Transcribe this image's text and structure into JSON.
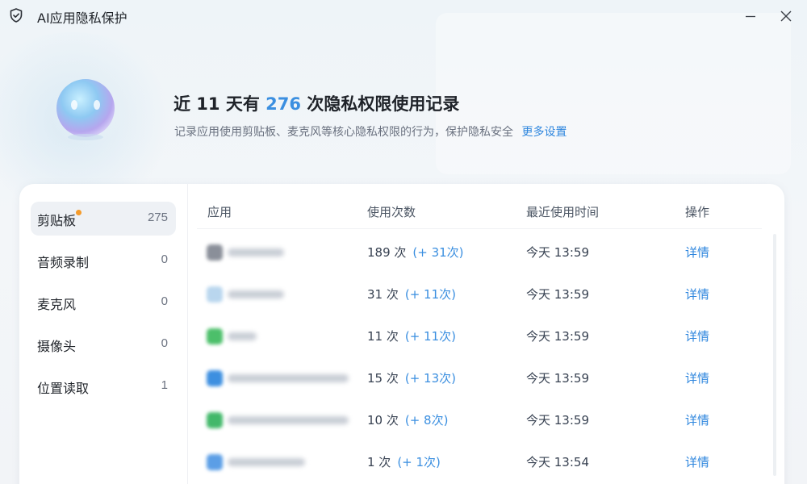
{
  "window": {
    "title": "AI应用隐私保护",
    "icons": {
      "app": "shield-icon",
      "minimize": "minimize-icon",
      "close": "close-icon"
    }
  },
  "header": {
    "headline_prefix": "近 11 天有 ",
    "headline_count": "276",
    "headline_suffix": " 次隐私权限使用记录",
    "subline": "记录应用使用剪贴板、麦克风等核心隐私权限的行为，保护隐私安全",
    "more_link": "更多设置"
  },
  "sidebar": {
    "items": [
      {
        "label": "剪贴板",
        "count": "275",
        "active": true,
        "dot": true
      },
      {
        "label": "音频录制",
        "count": "0",
        "active": false,
        "dot": false
      },
      {
        "label": "麦克风",
        "count": "0",
        "active": false,
        "dot": false
      },
      {
        "label": "摄像头",
        "count": "0",
        "active": false,
        "dot": false
      },
      {
        "label": "位置读取",
        "count": "1",
        "active": false,
        "dot": false
      }
    ]
  },
  "table": {
    "columns": [
      "应用",
      "使用次数",
      "最近使用时间",
      "操作"
    ],
    "rows": [
      {
        "count": "189 次",
        "delta": "(+ 31次)",
        "time": "今天 13:59",
        "action": "详情",
        "logo_color": "#8a8f99"
      },
      {
        "count": "31 次",
        "delta": "(+ 11次)",
        "time": "今天 13:59",
        "action": "详情",
        "logo_color": "#b9d6ee"
      },
      {
        "count": "11 次",
        "delta": "(+ 11次)",
        "time": "今天 13:59",
        "action": "详情",
        "logo_color": "#4cbf6a"
      },
      {
        "count": "15 次",
        "delta": "(+ 13次)",
        "time": "今天 13:59",
        "action": "详情",
        "logo_color": "#3d8fe0"
      },
      {
        "count": "10 次",
        "delta": "(+ 8次)",
        "time": "今天 13:59",
        "action": "详情",
        "logo_color": "#42b86a"
      },
      {
        "count": "1 次",
        "delta": "(+ 1次)",
        "time": "今天 13:54",
        "action": "详情",
        "logo_color": "#5b9ee6"
      }
    ]
  },
  "colors": {
    "accent": "#3b8fe0",
    "link": "#2e86de",
    "badge_dot": "#f59b2a"
  }
}
